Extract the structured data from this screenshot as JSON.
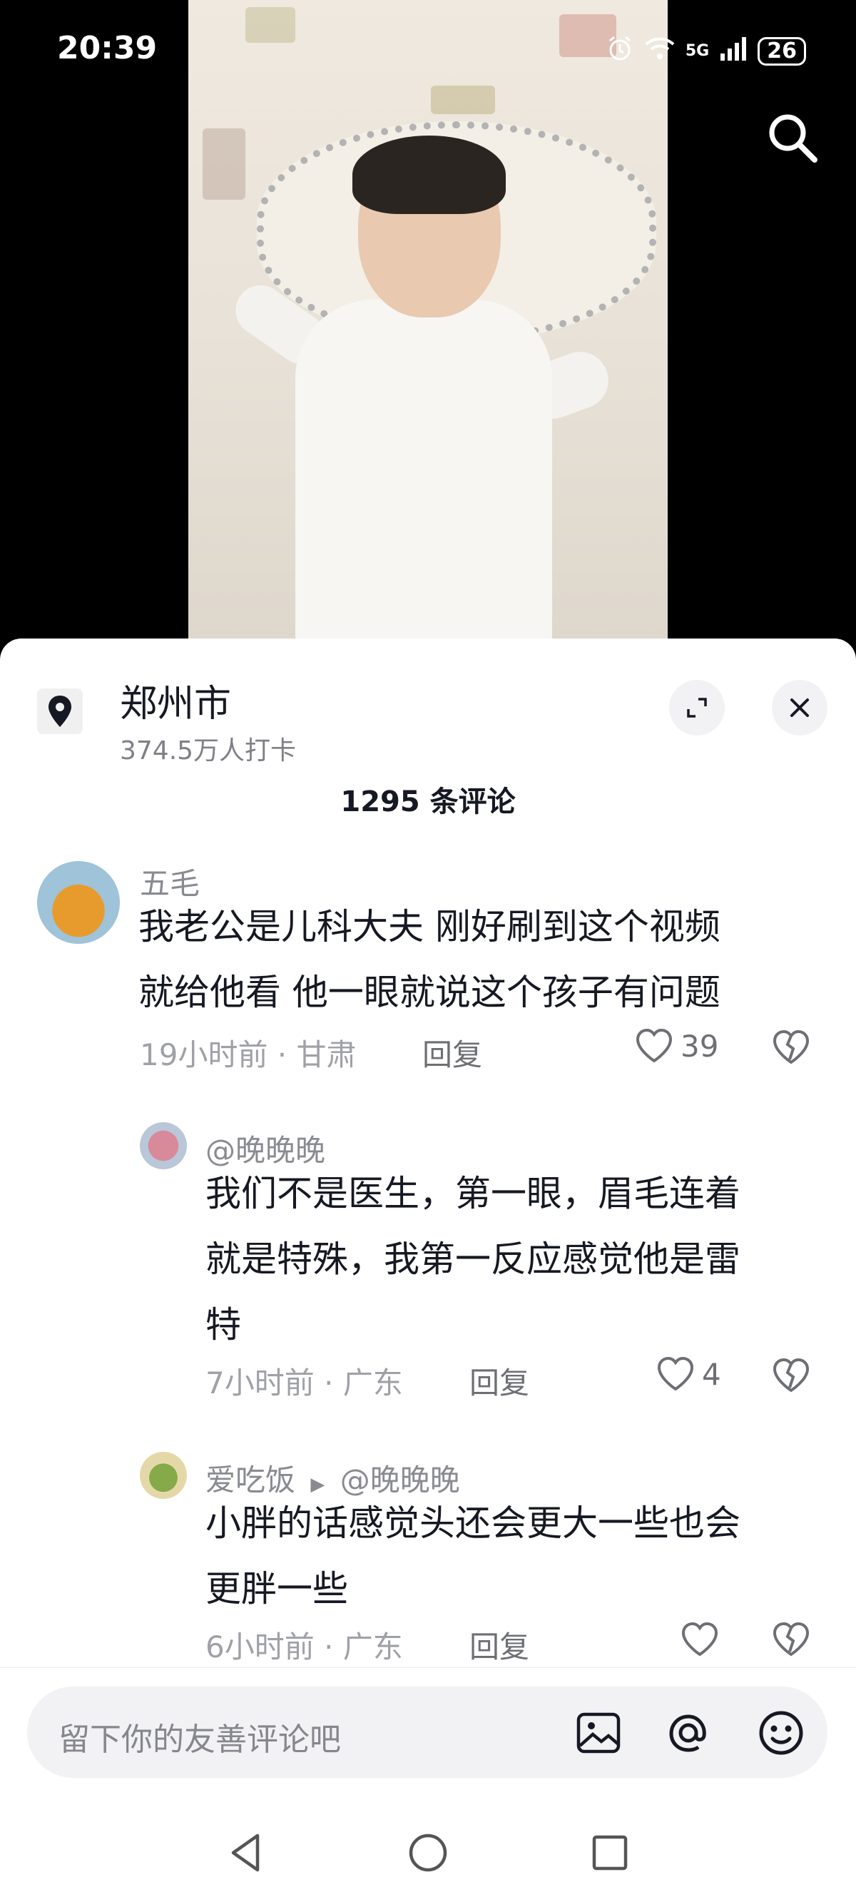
{
  "status": {
    "time": "20:39",
    "network": "5G",
    "battery": "26"
  },
  "location": {
    "name": "郑州市",
    "checkins": "374.5万人打卡"
  },
  "comments_header": "1295 条评论",
  "comments": [
    {
      "user": "五毛",
      "text_lines": [
        "我老公是儿科大夫 刚好刷到这个视频",
        "就给他看 他一眼就说这个孩子有问题"
      ],
      "time_location": "19小时前 · 甘肃",
      "reply_label": "回复",
      "likes": "39"
    },
    {
      "user": "@晚晚晚",
      "text_lines": [
        "我们不是医生，第一眼，眉毛连着",
        "就是特殊，我第一反应感觉他是雷",
        "特"
      ],
      "time_location": "7小时前 · 广东",
      "reply_label": "回复",
      "likes": "4"
    },
    {
      "user": "爱吃饭",
      "reply_to": "@晚晚晚",
      "text_lines": [
        "小胖的话感觉头还会更大一些也会",
        "更胖一些"
      ],
      "time_location": "6小时前 · 广东",
      "reply_label": "回复",
      "likes": ""
    }
  ],
  "input": {
    "placeholder": "留下你的友善评论吧"
  },
  "icons": {
    "search": "search-icon",
    "location": "location-pin-icon",
    "expand": "expand-icon",
    "close": "close-icon",
    "like": "heart-icon",
    "dislike": "broken-heart-icon",
    "image": "image-icon",
    "mention": "at-icon",
    "emoji": "emoji-icon",
    "back": "back-triangle-icon",
    "home": "home-circle-icon",
    "recents": "recents-square-icon"
  }
}
